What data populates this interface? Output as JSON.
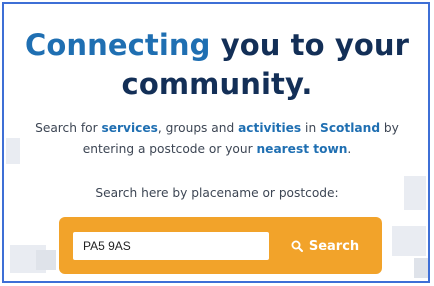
{
  "hero": {
    "title_line1_highlight": "Connecting",
    "title_line1_rest": " you to your",
    "title_line2": "community."
  },
  "description": {
    "t1": "Search for ",
    "k1": "services",
    "t2": ", groups and ",
    "k2": "activities",
    "t3": " in ",
    "k3": "Scotland",
    "t4": " by entering a postcode or your ",
    "k4": "nearest town",
    "t5": "."
  },
  "search": {
    "prompt": "Search here by placename or postcode:",
    "input_value": "PA5 9AS",
    "button_label": "Search",
    "button_icon": "search-icon"
  },
  "colors": {
    "heading": "#132f57",
    "accent_blue": "#1f6fb2",
    "orange": "#f2a32a",
    "frame": "#3e6fd6"
  }
}
